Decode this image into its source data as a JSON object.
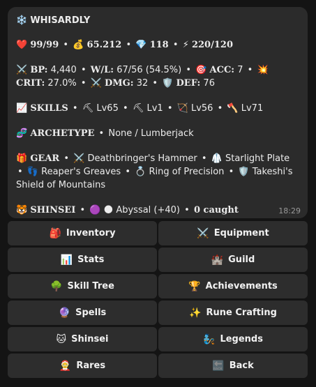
{
  "message": {
    "name": "WHISARDLY",
    "name_icon": "snowflake-icon",
    "hp": "99/99",
    "gold": "65.212",
    "gems": "118",
    "energy": "220/120",
    "bp_label": "BP:",
    "bp": "4,440",
    "wl_label": "W/L:",
    "wl": "67/56 (54.5%)",
    "acc_label": "ACC:",
    "acc": "7",
    "crit_label": "CRIT:",
    "crit": "27.0%",
    "dmg_label": "DMG:",
    "dmg": "32",
    "def_label": "DEF:",
    "def": "76",
    "skills_label": "SKILLS",
    "skills": [
      "Lv65",
      "Lv1",
      "Lv56",
      "Lv71"
    ],
    "archetype_label": "ARCHETYPE",
    "archetype": "None / Lumberjack",
    "gear_label": "GEAR",
    "gear": [
      "Deathbringer's Hammer",
      "Starlight Plate",
      "Reaper's Greaves",
      "Ring of Precision",
      "Takeshi's Shield of Mountains"
    ],
    "shinsei_label": "SHINSEI",
    "shinsei_name": "Abyssal (+40)",
    "shinsei_caught": "0 caught",
    "time": "18:29"
  },
  "buttons": [
    {
      "icon": "🎒",
      "icon_name": "backpack-icon",
      "label": "Inventory"
    },
    {
      "icon": "⚔️",
      "icon_name": "swords-icon",
      "label": "Equipment"
    },
    {
      "icon": "📊",
      "icon_name": "bar-chart-icon",
      "label": "Stats"
    },
    {
      "icon": "🏰",
      "icon_name": "castle-icon",
      "label": "Guild"
    },
    {
      "icon": "🌳",
      "icon_name": "tree-icon",
      "label": "Skill Tree"
    },
    {
      "icon": "🏆",
      "icon_name": "trophy-icon",
      "label": "Achievements"
    },
    {
      "icon": "🔮",
      "icon_name": "crystal-ball-icon",
      "label": "Spells"
    },
    {
      "icon": "✨",
      "icon_name": "sparkles-icon",
      "label": "Rune Crafting"
    },
    {
      "icon": "🐱",
      "icon_name": "cat-icon",
      "label": "Shinsei"
    },
    {
      "icon": "🧞",
      "icon_name": "genie-icon",
      "label": "Legends"
    },
    {
      "icon": "🤶",
      "icon_name": "santa-icon",
      "label": "Rares"
    },
    {
      "icon": "🔙",
      "icon_name": "back-arrow-icon",
      "label": "Back"
    }
  ]
}
